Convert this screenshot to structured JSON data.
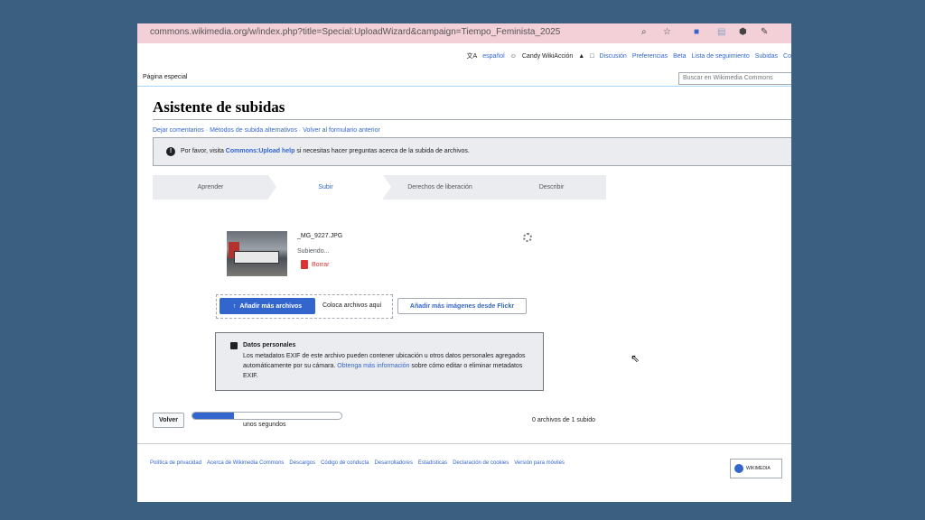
{
  "browser": {
    "url": "commons.wikimedia.org/w/index.php?title=Special:UploadWizard&campaign=Tiempo_Feminista_2025"
  },
  "topnav": {
    "language": "español",
    "user": "Candy WikiAcción",
    "items": [
      "Discusión",
      "Preferencias",
      "Beta",
      "Lista de seguimiento",
      "Subidas",
      "Co"
    ]
  },
  "tab": {
    "label": "Página especial"
  },
  "search": {
    "placeholder": "Buscar en Wikimedia Commons"
  },
  "page": {
    "title": "Asistente de subidas",
    "links": [
      "Dejar comentarios",
      "Métodos de subida alternativos",
      "Volver al formulario anterior"
    ],
    "separator": "·"
  },
  "notice": {
    "before": "Por favor, visita ",
    "link": "Commons:Upload help",
    "after": " si necesitas hacer preguntas acerca de la subida de archivos."
  },
  "steps": [
    "Aprender",
    "Subir",
    "Derechos de liberación",
    "Describir"
  ],
  "upload": {
    "filename": "_MG_9227.JPG",
    "status": "Subiendo...",
    "remove_label": "Borrar"
  },
  "actions": {
    "add_more": "Añadir más archivos",
    "drop_here": "Coloca archivos aquí",
    "flickr": "Añadir más imágenes desde Flickr"
  },
  "privacy": {
    "title": "Datos personales",
    "body_before": "Los metadatos EXIF de este archivo pueden contener ubicación u otros datos personales agregados automáticamente por su cámara. ",
    "link": "Obtenga más información",
    "body_after": " sobre cómo editar o eliminar metadatos EXIF."
  },
  "bottom": {
    "back": "Volver",
    "progress_fraction": 0.28,
    "time_left": "unos segundos",
    "count": "0 archivos de 1 subido"
  },
  "footer": {
    "links": [
      "Política de privacidad",
      "Acerca de Wikimedia Commons",
      "Descargos",
      "Código de conducta",
      "Desarrolladores",
      "Estadísticas",
      "Declaración de cookies",
      "Versión para móviles"
    ],
    "logo_text": "WIKIMEDIA"
  },
  "colors": {
    "link": "#3366cc",
    "danger": "#d33333",
    "url_bar": "#f3cfd7"
  },
  "icons": [
    "search-icon",
    "star-icon",
    "bell-icon",
    "inbox-icon",
    "translate-icon",
    "user-icon",
    "upload-icon",
    "trash-icon",
    "lock-icon",
    "info-icon",
    "spinner-icon"
  ]
}
